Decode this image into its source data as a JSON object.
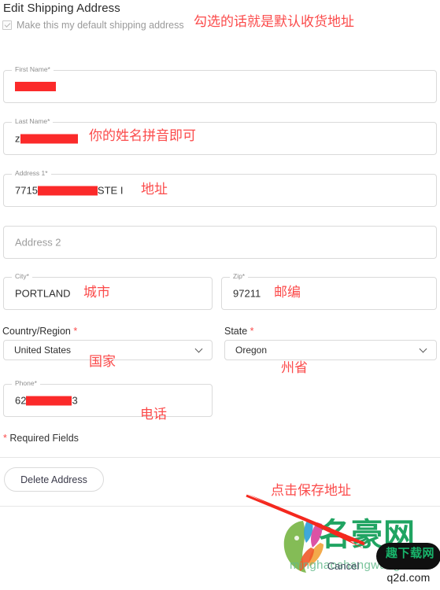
{
  "header": {
    "title": "Edit Shipping Address",
    "default_checkbox_label": "Make this my default shipping address",
    "default_checkbox_checked": true
  },
  "annotations": {
    "default_address": "勾选的话就是默认收货地址",
    "name_pinyin": "你的姓名拼音即可",
    "address": "地址",
    "city": "城市",
    "zip": "邮编",
    "country": "国家",
    "state": "州省",
    "phone": "电话",
    "save_address": "点击保存地址"
  },
  "form": {
    "first_name": {
      "label": "First Name*",
      "value_prefix": "",
      "value_suffix": "",
      "redacted": true
    },
    "last_name": {
      "label": "Last Name*",
      "value_prefix": "z",
      "value_suffix": "",
      "redacted": true
    },
    "address1": {
      "label": "Address 1*",
      "value_prefix": "7715 ",
      "value_suffix": " STE I",
      "redacted": true
    },
    "address2": {
      "label": "",
      "placeholder": "Address 2",
      "value": ""
    },
    "city": {
      "label": "City*",
      "value": "PORTLAND"
    },
    "zip": {
      "label": "Zip*",
      "value": "97211"
    },
    "country": {
      "label": "Country/Region",
      "required_mark": "*",
      "value": "United States"
    },
    "state": {
      "label": "State",
      "required_mark": "*",
      "value": "Oregon"
    },
    "phone": {
      "label": "Phone*",
      "value_prefix": "62",
      "value_suffix": "3",
      "redacted": true
    }
  },
  "footer": {
    "required_star": "*",
    "required_text": " Required Fields",
    "delete_button": "Delete Address",
    "cancel_link": "Cancel"
  },
  "watermarks": {
    "primary_text": "名豪网",
    "primary_sub": "minghaoshangwang.com",
    "secondary_text": "趣下载网",
    "secondary_url": "q2d.com"
  },
  "colors": {
    "annotation_red": "#fb4b4b",
    "redaction_red": "#fb2a2a",
    "field_border": "#dadada",
    "watermark_green": "#15a05a"
  }
}
